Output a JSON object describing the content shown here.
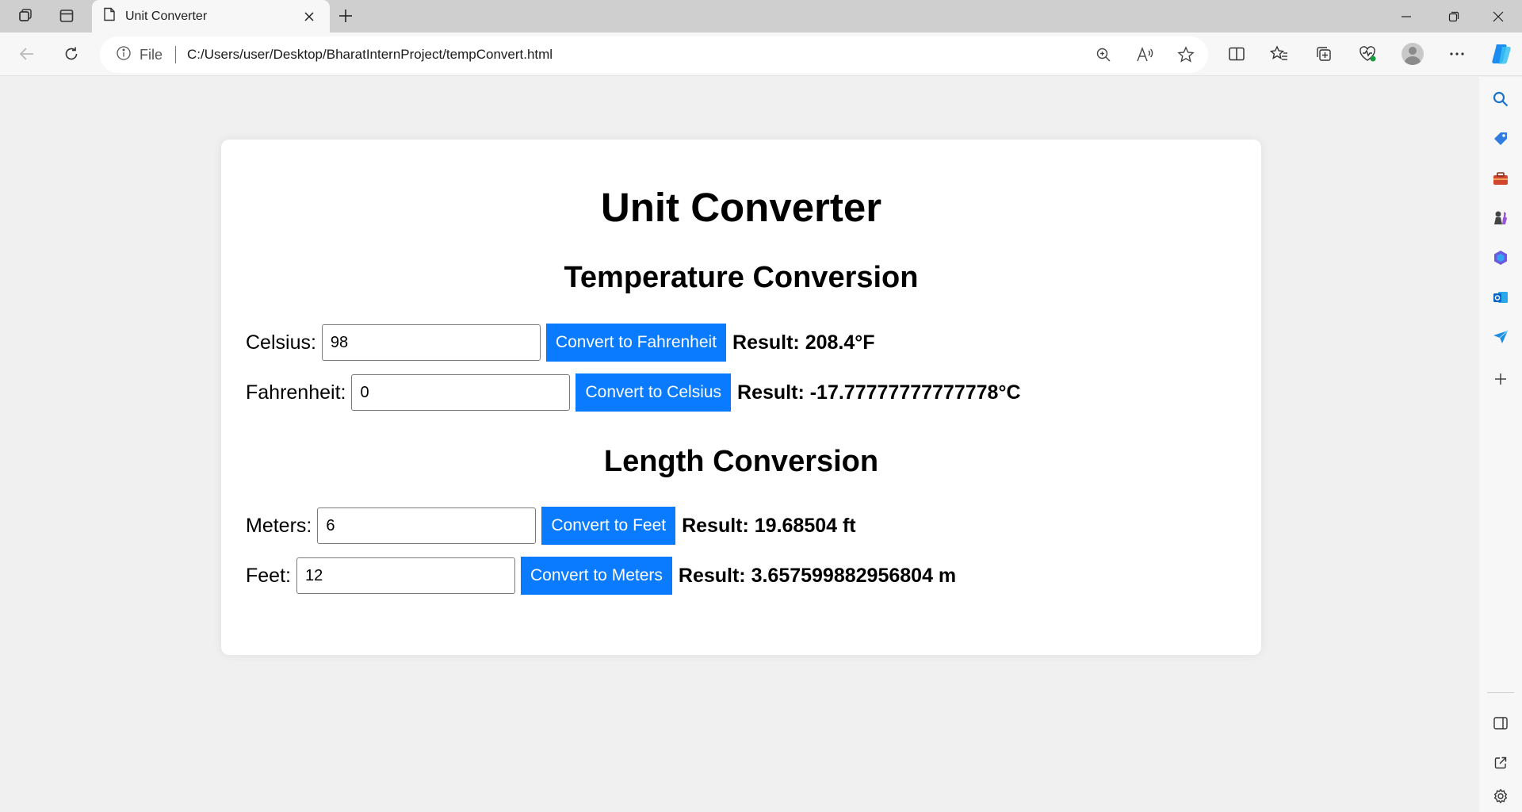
{
  "browser": {
    "tab_title": "Unit Converter",
    "address_scheme": "File",
    "address_url": "C:/Users/user/Desktop/BharatInternProject/tempConvert.html",
    "icons": [
      "workspaces-icon",
      "vertical-tabs-icon",
      "page-icon",
      "close-icon",
      "plus-icon",
      "minimize-icon",
      "restore-icon",
      "window-close-icon",
      "back-icon",
      "refresh-icon",
      "info-icon",
      "zoom-icon",
      "read-aloud-icon",
      "favorite-star-icon",
      "split-screen-icon",
      "favorites-icon",
      "collections-icon",
      "browser-essentials-icon",
      "profile-avatar-icon",
      "more-icon",
      "copilot-icon"
    ]
  },
  "sidebar": {
    "icons": [
      "search-icon",
      "shopping-tag-icon",
      "tools-briefcase-icon",
      "games-chess-icon",
      "microsoft365-icon",
      "outlook-icon",
      "drop-send-icon",
      "add-icon",
      "hide-sidebar-icon",
      "open-external-icon",
      "settings-gear-icon"
    ]
  },
  "page": {
    "title": "Unit Converter",
    "temperature": {
      "heading": "Temperature Conversion",
      "celsius": {
        "label": "Celsius:",
        "value": "98",
        "button": "Convert to Fahrenheit",
        "result": "Result: 208.4°F"
      },
      "fahrenheit": {
        "label": "Fahrenheit:",
        "value": "0",
        "button": "Convert to Celsius",
        "result": "Result: -17.77777777777778°C"
      }
    },
    "length": {
      "heading": "Length Conversion",
      "meters": {
        "label": "Meters:",
        "value": "6",
        "button": "Convert to Feet",
        "result": "Result: 19.68504 ft"
      },
      "feet": {
        "label": "Feet:",
        "value": "12",
        "button": "Convert to Meters",
        "result": "Result: 3.657599882956804 m"
      }
    }
  },
  "colors": {
    "button_bg": "#0a7bff",
    "page_bg": "#f0f0f0",
    "card_bg": "#ffffff",
    "tabstrip_bg": "#cfcfcf"
  }
}
